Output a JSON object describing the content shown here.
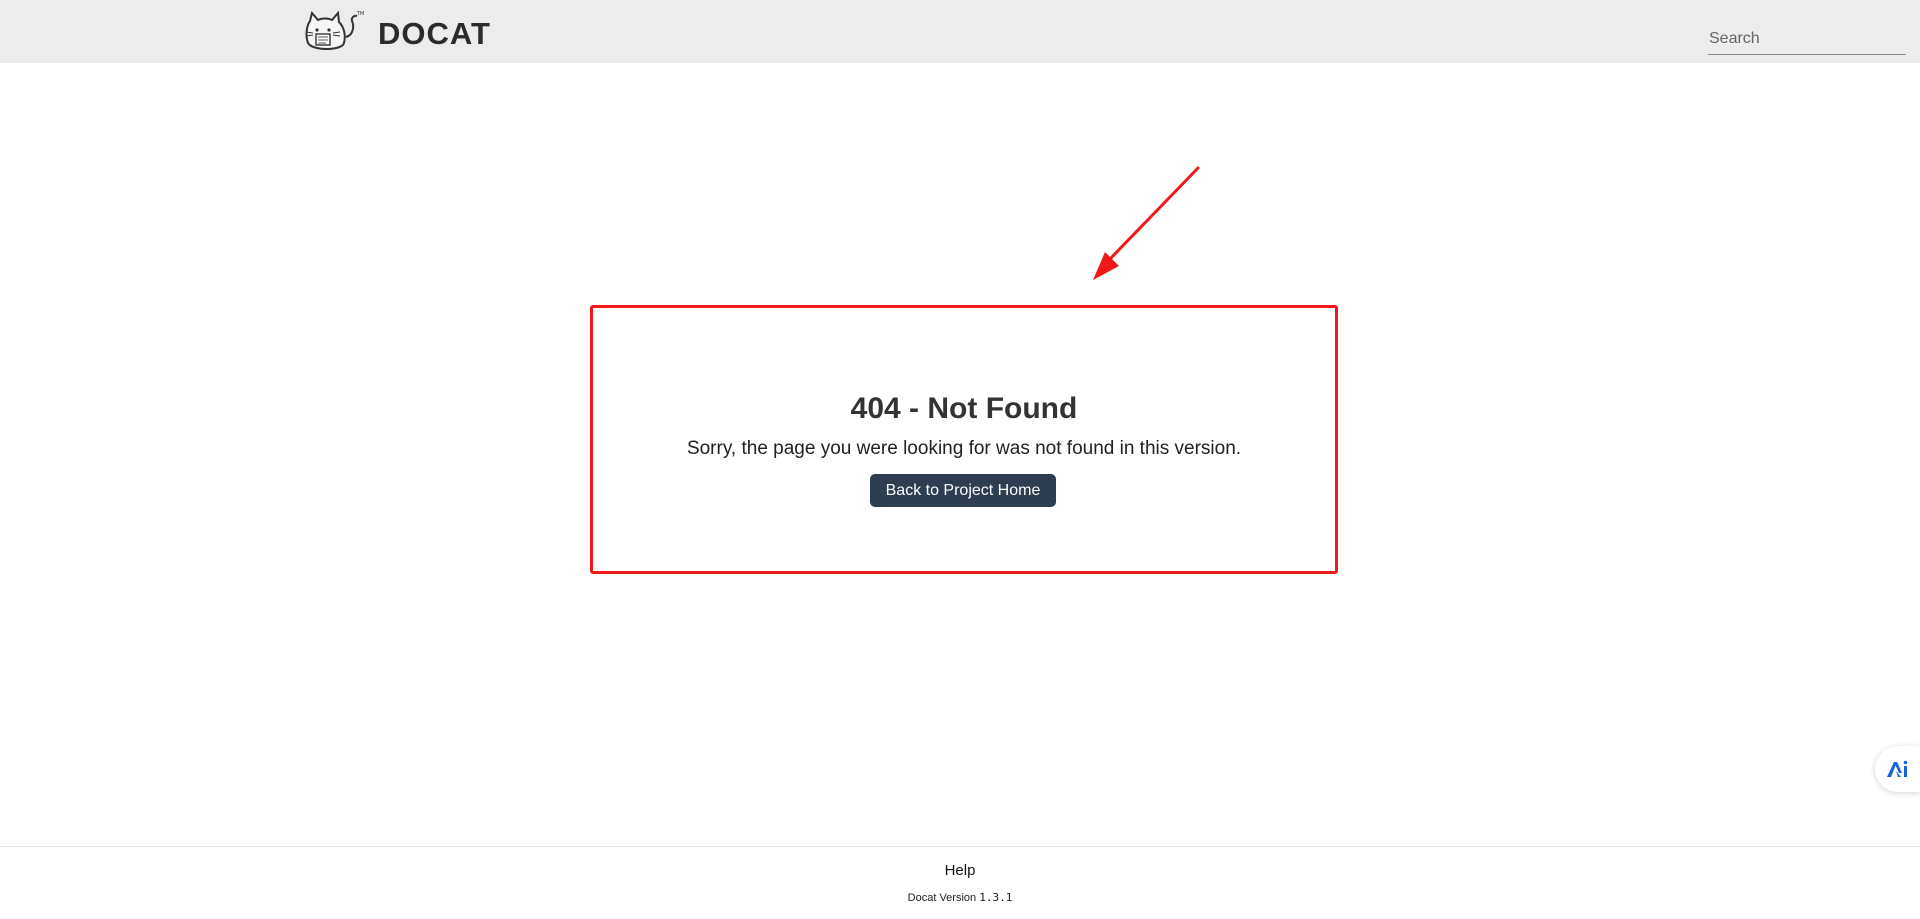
{
  "header": {
    "logo_text": "DOCAT",
    "logo_icon": "cat-logo-icon",
    "search_placeholder": "Search"
  },
  "notfound": {
    "title": "404 - Not Found",
    "message": "Sorry, the page you were looking for was not found in this version.",
    "button_label": "Back to Project Home"
  },
  "footer": {
    "help_label": "Help",
    "version_prefix": "Docat Version",
    "version_number": "1.3.1"
  },
  "floating_widget": {
    "icon": "assistant-icon"
  },
  "annotation": {
    "highlight_color": "#f01818",
    "arrow_color": "#f01818"
  },
  "colors": {
    "header_bg": "#ececec",
    "button_bg": "#2e3e50",
    "widget_icon": "#1565d8"
  }
}
